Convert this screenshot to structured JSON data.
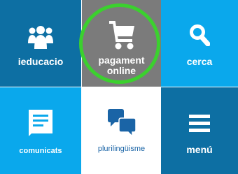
{
  "colors": {
    "dark_blue": "#0d6fa3",
    "light_blue": "#0aa8ec",
    "gray": "#7b7b7b",
    "white": "#ffffff",
    "highlight_ring": "#3bd12e",
    "speech_blue": "#1a64a6"
  },
  "tiles": [
    {
      "label": "ieducacio",
      "icon": "users-group-icon"
    },
    {
      "label_line1": "pagament",
      "label_line2": "online",
      "icon": "shopping-cart-icon"
    },
    {
      "label": "cerca",
      "icon": "search-icon"
    },
    {
      "label": "comunicats",
      "icon": "document-icon"
    },
    {
      "label": "plurilingüisme",
      "icon": "speech-bubbles-icon"
    },
    {
      "label": "menú",
      "icon": "hamburger-menu-icon"
    }
  ]
}
